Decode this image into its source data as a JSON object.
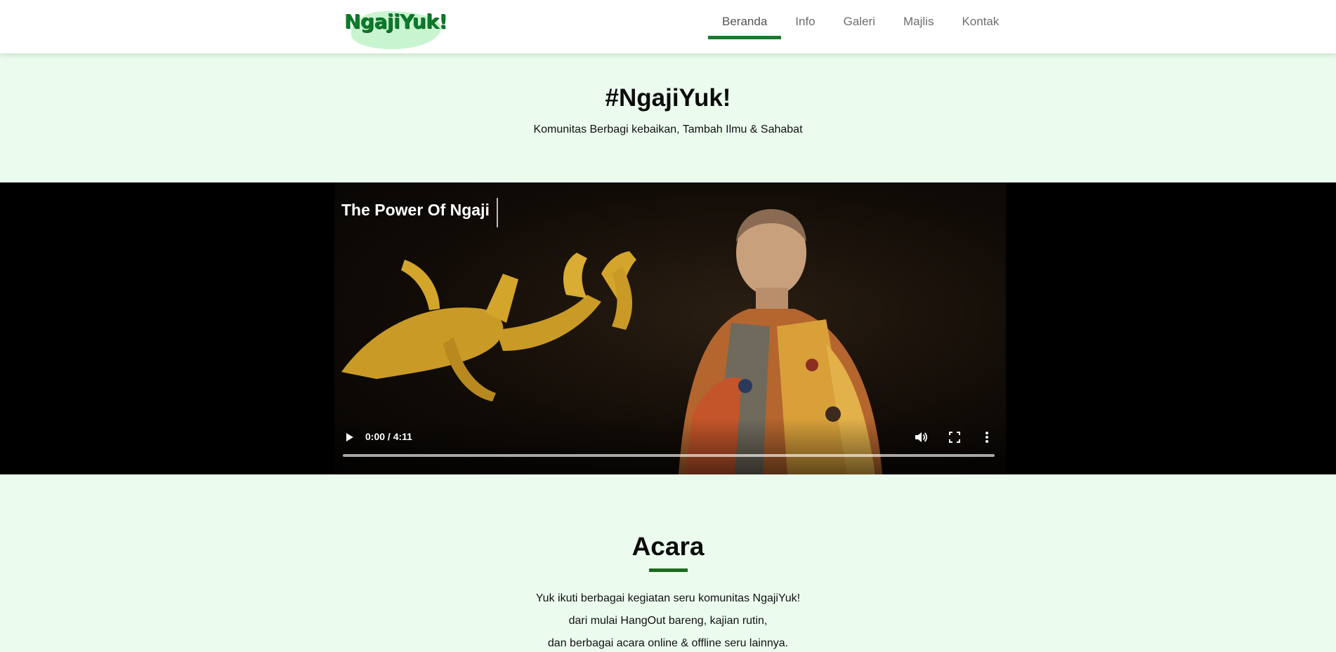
{
  "header": {
    "logo_text": "NgajiYuk!",
    "nav": [
      {
        "label": "Beranda",
        "active": true
      },
      {
        "label": "Info",
        "active": false
      },
      {
        "label": "Galeri",
        "active": false
      },
      {
        "label": "Majlis",
        "active": false
      },
      {
        "label": "Kontak",
        "active": false
      }
    ]
  },
  "hero": {
    "title": "#NgajiYuk!",
    "subtitle": "Komunitas Berbagi kebaikan, Tambah Ilmu & Sahabat"
  },
  "video": {
    "title": "The Power Of Ngaji",
    "time": "0:00 / 4:11",
    "progress_fraction": 0,
    "icons": [
      "play-icon",
      "volume-icon",
      "fullscreen-icon",
      "more-vert-icon"
    ]
  },
  "acara": {
    "title": "Acara",
    "lines": [
      "Yuk ikuti berbagai kegiatan seru komunitas NgajiYuk!",
      "dari mulai HangOut bareng, kajian rutin,",
      "dan berbagai acara online & offline seru lainnya."
    ]
  },
  "colors": {
    "brand_green": "#1c7a2f",
    "page_background": "#ebfcee",
    "logo_blob": "#c9f4d0"
  }
}
